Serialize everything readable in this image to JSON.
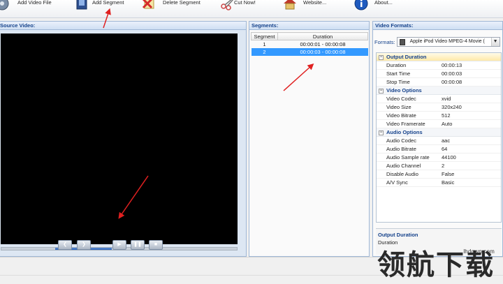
{
  "toolbar": {
    "add_video_file": "Add Video File",
    "add_segment": "Add Segment",
    "delete_segment": "Delete Segment",
    "cut_now": "Cut Now!",
    "website": "Website...",
    "about": "About..."
  },
  "source": {
    "title": "Source Video:",
    "seek_progress": 0.47
  },
  "segments": {
    "title": "Segments:",
    "col_segment": "Segment",
    "col_duration": "Duration",
    "rows": [
      {
        "segment": "1",
        "duration": "00:00:01 - 00:00:08"
      },
      {
        "segment": "2",
        "duration": "00:00:03 - 00:00:08"
      }
    ],
    "selected_index": 1
  },
  "formats": {
    "title": "Video Formats:",
    "label": "Formats:",
    "selected": "Apple iPod Video MPEG-4 Movie (",
    "categories": [
      {
        "name": "Output Duration",
        "rows": [
          {
            "k": "Duration",
            "v": "00:00:13"
          },
          {
            "k": "Start Time",
            "v": "00:00:03"
          },
          {
            "k": "Stop Time",
            "v": "00:00:08"
          }
        ]
      },
      {
        "name": "Video Options",
        "rows": [
          {
            "k": "Video Codec",
            "v": "xvid"
          },
          {
            "k": "Video Size",
            "v": "320x240"
          },
          {
            "k": "Video Bitrate",
            "v": "512"
          },
          {
            "k": "Video Framerate",
            "v": "Auto"
          }
        ]
      },
      {
        "name": "Audio Options",
        "rows": [
          {
            "k": "Audio Codec",
            "v": "aac"
          },
          {
            "k": "Audio Bitrate",
            "v": "64"
          },
          {
            "k": "Audio Sample rate",
            "v": "44100"
          },
          {
            "k": "Audio Channel",
            "v": "2"
          },
          {
            "k": "Disable Audio",
            "v": "False"
          },
          {
            "k": "A/V Sync",
            "v": "Basic"
          }
        ]
      }
    ],
    "desc_title": "Output Duration",
    "desc_text": "Duration"
  },
  "watermark": {
    "url": "lhdown.com",
    "big": "领航下载"
  },
  "colors": {
    "accent": "#3399ff",
    "header_text": "#15428b",
    "arrow": "#e02020"
  }
}
